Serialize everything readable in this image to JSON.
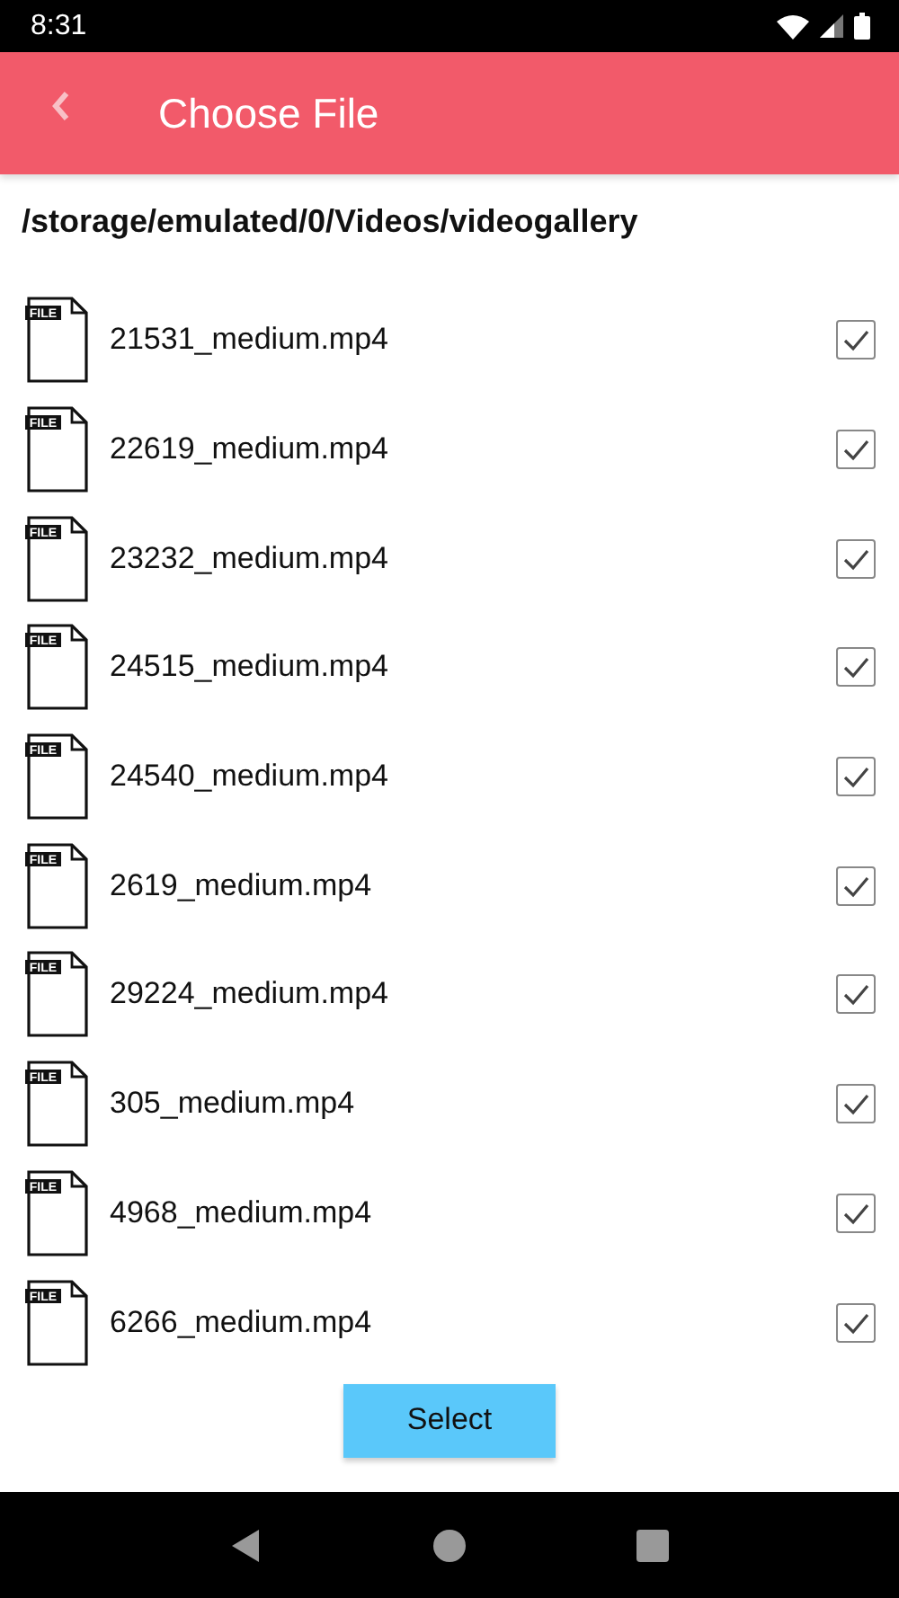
{
  "status_bar": {
    "time": "8:31"
  },
  "app_bar": {
    "title": "Choose File"
  },
  "path": "/storage/emulated/0/Videos/videogallery",
  "files": [
    {
      "icon_label": "FILE",
      "name": "21531_medium.mp4",
      "checked": true
    },
    {
      "icon_label": "FILE",
      "name": "22619_medium.mp4",
      "checked": true
    },
    {
      "icon_label": "FILE",
      "name": "23232_medium.mp4",
      "checked": true
    },
    {
      "icon_label": "FILE",
      "name": "24515_medium.mp4",
      "checked": true
    },
    {
      "icon_label": "FILE",
      "name": "24540_medium.mp4",
      "checked": true
    },
    {
      "icon_label": "FILE",
      "name": "2619_medium.mp4",
      "checked": true
    },
    {
      "icon_label": "FILE",
      "name": "29224_medium.mp4",
      "checked": true
    },
    {
      "icon_label": "FILE",
      "name": "305_medium.mp4",
      "checked": true
    },
    {
      "icon_label": "FILE",
      "name": "4968_medium.mp4",
      "checked": true
    },
    {
      "icon_label": "FILE",
      "name": "6266_medium.mp4",
      "checked": true
    }
  ],
  "select_button": "Select"
}
